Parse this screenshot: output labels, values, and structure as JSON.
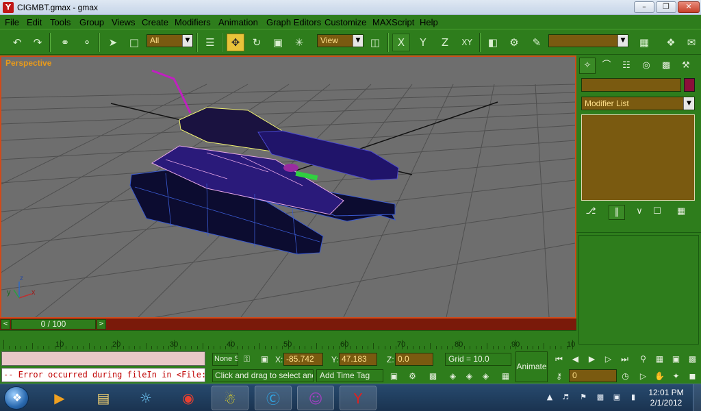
{
  "window": {
    "title": "CIGMBT.gmax - gmax",
    "minimize": "–",
    "maximize": "❐",
    "close": "✕"
  },
  "menu": [
    "File",
    "Edit",
    "Tools",
    "Group",
    "Views",
    "Create",
    "Modifiers",
    "Animation",
    "Graph Editors",
    "Customize",
    "MAXScript",
    "Help"
  ],
  "toolbar": {
    "selection_filter": "All",
    "ref_coord": "View",
    "axis_x": "X",
    "axis_y": "Y",
    "axis_z": "Z",
    "axis_xy": "XY",
    "named_selection": ""
  },
  "viewport": {
    "label": "Perspective",
    "axis_x": "x",
    "axis_y": "y",
    "axis_z": "z"
  },
  "command_panel": {
    "object_name": "",
    "modifier_list": "Modifier List"
  },
  "time_slider": {
    "position": "0 / 100",
    "prev": "<",
    "next": ">"
  },
  "trackbar": {
    "ticks": [
      "10",
      "20",
      "30",
      "40",
      "50",
      "60",
      "70",
      "80",
      "90",
      "10"
    ]
  },
  "status": {
    "listener_output": "-- Error occurred during fileIn in <File:C",
    "selection": "None S",
    "x_label": "X:",
    "x_value": "-85.742",
    "y_label": "Y:",
    "y_value": "47.183",
    "z_label": "Z:",
    "z_value": "0.0",
    "grid": "Grid = 10.0",
    "prompt": "Click and drag to select and m",
    "time_tag": "Add Time Tag",
    "animate": "Animate",
    "frame": "0"
  },
  "taskbar": {
    "time": "12:01 PM",
    "date": "2/1/2012"
  },
  "colors": {
    "ui_green": "#2e7d1c",
    "field_brown": "#7a5a10",
    "viewport_grey": "#6e6e6e",
    "viewport_border": "#d04a1a",
    "label_orange": "#e89a1a"
  }
}
